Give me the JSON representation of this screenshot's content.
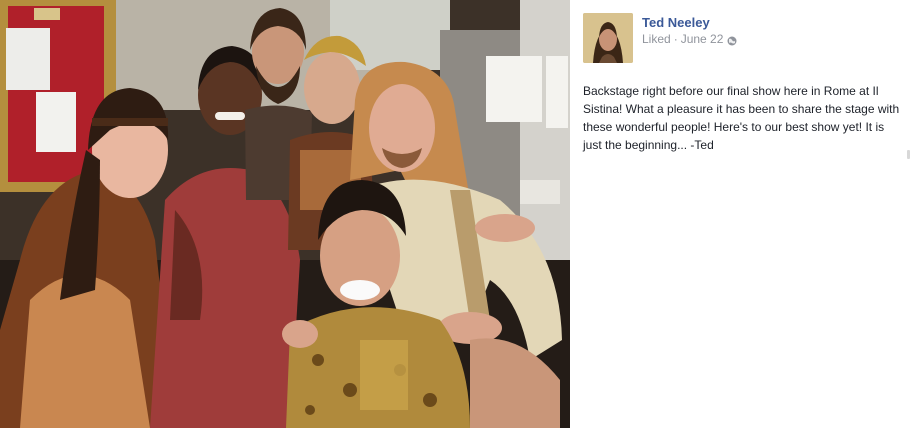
{
  "post": {
    "author": {
      "name": "Ted Neeley",
      "avatar_icon": "profile-photo"
    },
    "meta": {
      "status": "Liked",
      "separator": "·",
      "date": "June 22",
      "privacy_icon": "globe-icon"
    },
    "caption": "Backstage right before our final show here in Rome at Il Sistina! What a pleasure it has been to share the stage with these wonderful people! Here's to our best show yet! It is just the beginning... -Ted"
  },
  "photo": {
    "bulletin_notice_text": "",
    "description_icon": "backstage-group-photo"
  },
  "colors": {
    "author_link": "#3b5998",
    "meta_text": "#90949c",
    "caption_text": "#1d2129"
  }
}
